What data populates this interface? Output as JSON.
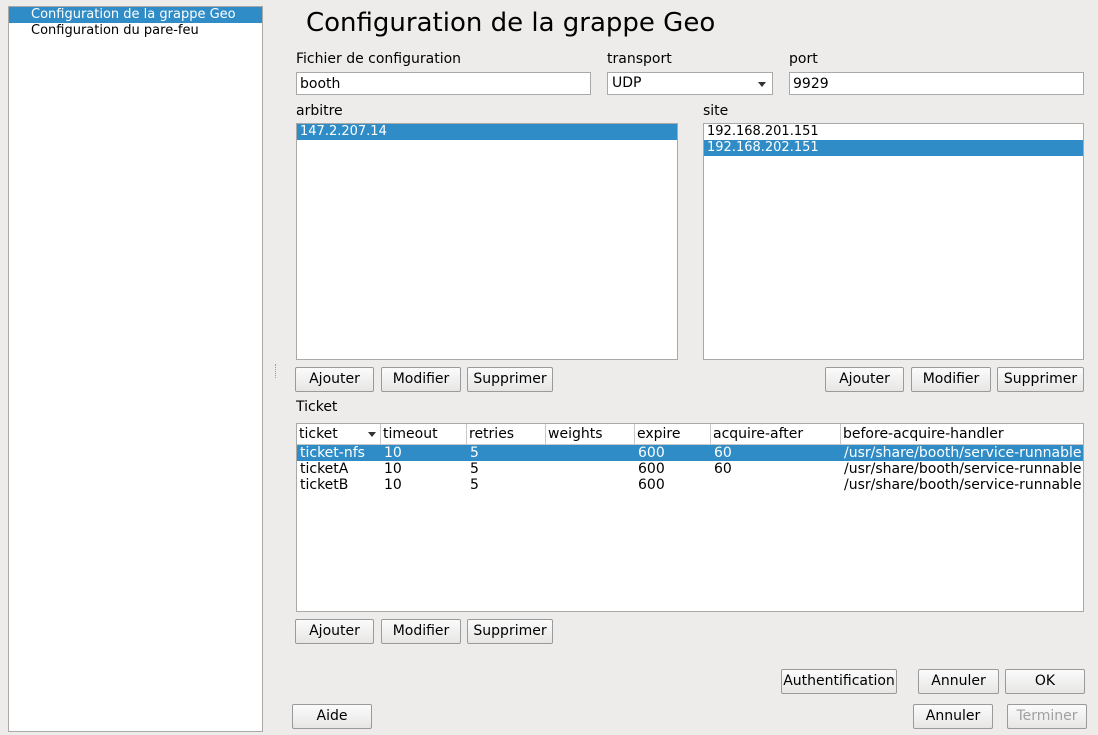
{
  "sidebar": {
    "items": [
      {
        "label": "Configuration de la grappe Geo",
        "selected": true
      },
      {
        "label": "Configuration du pare-feu",
        "selected": false
      }
    ]
  },
  "page_title": "Configuration de la grappe Geo",
  "config_file": {
    "label": "Fichier de configuration",
    "value": "booth"
  },
  "transport": {
    "label": "transport",
    "value": "UDP"
  },
  "port": {
    "label": "port",
    "value": "9929"
  },
  "arbitrator": {
    "label": "arbitre",
    "items": [
      "147.2.207.14"
    ],
    "selected_index": 0,
    "add_label": "Ajouter",
    "edit_label": "Modifier",
    "delete_label": "Supprimer"
  },
  "site": {
    "label": "site",
    "items": [
      "192.168.201.151",
      "192.168.202.151"
    ],
    "selected_index": 1,
    "add_label": "Ajouter",
    "edit_label": "Modifier",
    "delete_label": "Supprimer"
  },
  "ticket": {
    "label": "Ticket",
    "columns": [
      "ticket",
      "timeout",
      "retries",
      "weights",
      "expire",
      "acquire-after",
      "before-acquire-handler"
    ],
    "rows": [
      [
        "ticket-nfs",
        "10",
        "5",
        "",
        "600",
        "60",
        "/usr/share/booth/service-runnable"
      ],
      [
        "ticketA",
        "10",
        "5",
        "",
        "600",
        "60",
        "/usr/share/booth/service-runnable"
      ],
      [
        "ticketB",
        "10",
        "5",
        "",
        "600",
        "",
        "/usr/share/booth/service-runnable"
      ]
    ],
    "selected_index": 0,
    "add_label": "Ajouter",
    "edit_label": "Modifier",
    "delete_label": "Supprimer"
  },
  "buttons": {
    "authentication": "Authentification",
    "cancel_dialog": "Annuler",
    "ok": "OK",
    "help": "Aide",
    "cancel": "Annuler",
    "finish": "Terminer"
  },
  "colors": {
    "selection": "#308cc6",
    "background": "#edeceb"
  }
}
